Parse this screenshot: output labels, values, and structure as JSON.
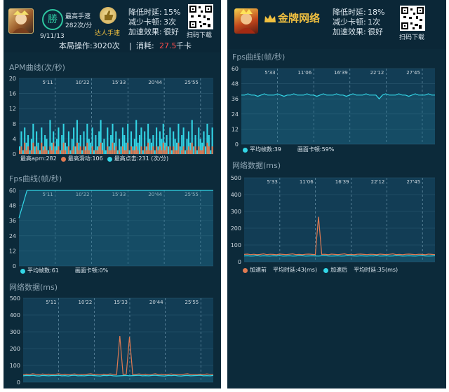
{
  "left": {
    "header": {
      "win_text": "勝",
      "rank_title": "最高手速",
      "rank_value": "282次/分",
      "badge_label": "达人手速",
      "date": "9/11/13",
      "reduce_delay_label": "降低时延:",
      "reduce_delay_value": "15%",
      "reduce_lag_label": "减少卡顿:",
      "reduce_lag_value": "3次",
      "effect_label": "加速效果:",
      "effect_value": "很好",
      "scan_label": "扫码下载",
      "ops_text": "本局操作:3020次",
      "separator": "|",
      "cost_label": "消耗:",
      "cost_value": "27.5",
      "cost_unit": "千卡"
    },
    "apm": {
      "title": "APM曲线(次/秒)",
      "y_ticks": [
        "20",
        "16",
        "12",
        "8",
        "4",
        "0"
      ],
      "x_ticks": [
        "5'11",
        "10'22",
        "15'33",
        "20'44",
        "25'55"
      ],
      "legend": {
        "max_apm": "最高apm:282",
        "max_swipe": "最高滑动:106",
        "max_tap": "最高点击:231 (次/分)"
      }
    },
    "fps": {
      "title": "Fps曲线(帧/秒)",
      "y_ticks": [
        "60",
        "48",
        "36",
        "24",
        "12",
        "0"
      ],
      "x_ticks": [
        "5'11",
        "10'22",
        "15'33",
        "20'44",
        "25'55"
      ],
      "legend": {
        "avg": "平均帧数:61",
        "stutter": "画面卡顿:0%"
      }
    },
    "net": {
      "title": "网络数据(ms)",
      "y_ticks": [
        "500",
        "400",
        "300",
        "200",
        "100",
        "0"
      ],
      "x_ticks": [
        "5'11",
        "10'22",
        "15'33",
        "20'44",
        "25'55"
      ]
    }
  },
  "right": {
    "header": {
      "logo_text": "金牌网络",
      "reduce_delay_label": "降低时延:",
      "reduce_delay_value": "18%",
      "reduce_lag_label": "减少卡顿:",
      "reduce_lag_value": "1次",
      "effect_label": "加速效果:",
      "effect_value": "很好",
      "scan_label": "扫码下载"
    },
    "fps": {
      "title": "Fps曲线(帧/秒)",
      "y_ticks": [
        "60",
        "48",
        "36",
        "24",
        "12",
        "0"
      ],
      "x_ticks": [
        "5'33",
        "11'06",
        "16'39",
        "22'12",
        "27'45"
      ],
      "legend": {
        "avg": "平均帧数:39",
        "stutter": "画面卡顿:59%"
      }
    },
    "net": {
      "title": "网络数据(ms)",
      "y_ticks": [
        "500",
        "400",
        "300",
        "200",
        "100",
        "0"
      ],
      "x_ticks": [
        "5'33",
        "11'06",
        "16'39",
        "22'12",
        "27'45"
      ],
      "legend": {
        "before_label": "加速前",
        "before_avg": "平均时延:43(ms)",
        "after_label": "加速后",
        "after_avg": "平均时延:35(ms)"
      }
    }
  },
  "colors": {
    "bg": "#0c2a3a",
    "plot": "#123d55",
    "cyan": "#33d6e6",
    "orange": "#e07a52",
    "gold": "#f0c040",
    "red": "#ff4b4b",
    "text": "#dbe6ee"
  },
  "chart_data": [
    {
      "type": "bar",
      "title": "APM曲线(次/秒)",
      "x_ticks": [
        "5'11",
        "10'22",
        "15'33",
        "20'44",
        "25'55"
      ],
      "ylim": [
        0,
        20
      ],
      "series": [
        {
          "name": "最高点击",
          "color": "#33d6e6",
          "values": [
            2,
            6,
            1,
            7,
            3,
            5,
            1,
            4,
            8,
            2,
            6,
            3,
            1,
            7,
            2,
            5,
            4,
            1,
            9,
            3,
            6,
            2,
            4,
            7,
            1,
            5,
            8,
            3,
            2,
            6,
            1,
            4,
            7,
            2,
            9,
            3,
            5,
            1,
            6,
            2,
            8,
            4,
            3,
            7,
            1,
            5,
            2,
            6,
            9,
            3,
            4,
            1,
            7,
            2,
            5,
            8,
            3,
            6,
            1,
            4,
            2,
            7,
            5,
            3,
            8,
            1,
            6,
            2,
            4,
            9,
            3,
            5,
            7,
            1,
            6,
            2,
            8,
            4,
            3,
            5,
            1,
            7,
            2,
            6,
            4,
            8,
            3,
            5,
            2,
            7,
            1,
            6,
            4,
            3,
            8,
            2,
            5,
            7,
            1,
            4,
            6,
            3,
            9,
            2,
            5,
            1,
            7,
            4,
            3,
            6,
            2,
            8,
            5,
            1,
            7
          ]
        },
        {
          "name": "最高滑动",
          "color": "#e07a52",
          "values": [
            1,
            2,
            0,
            3,
            1,
            2,
            0,
            1,
            3,
            0,
            2,
            1,
            0,
            3,
            1,
            2,
            1,
            0,
            2,
            1,
            3,
            0,
            1,
            2,
            0,
            1,
            3,
            1,
            0,
            2,
            0,
            1,
            2,
            0,
            3,
            1,
            2,
            0,
            2,
            1,
            3,
            1,
            0,
            2,
            0,
            1,
            1,
            2,
            3,
            1,
            0,
            0,
            2,
            1,
            1,
            3,
            1,
            2,
            0,
            1,
            0,
            2,
            1,
            1,
            3,
            0,
            2,
            1,
            1,
            2,
            1,
            0,
            2,
            0,
            2,
            1,
            3,
            1,
            1,
            2,
            0,
            2,
            1,
            2,
            1,
            3,
            1,
            2,
            0,
            2,
            0,
            2,
            1,
            1,
            3,
            0,
            1,
            2,
            0,
            1,
            2,
            1,
            3,
            0,
            2,
            0,
            2,
            1,
            1,
            2,
            0,
            3,
            2,
            0,
            2
          ]
        }
      ]
    },
    {
      "type": "line",
      "title": "Fps曲线(帧/秒)",
      "x_ticks": [
        "5'11",
        "10'22",
        "15'33",
        "20'44",
        "25'55"
      ],
      "ylim": [
        0,
        60
      ],
      "series": [
        {
          "name": "平均帧数",
          "color": "#33d6e6",
          "values": [
            38,
            60,
            61,
            61,
            61,
            61,
            61,
            61,
            61,
            61,
            61,
            61,
            61,
            61,
            61,
            61,
            61,
            61,
            61,
            61,
            61,
            61,
            61,
            61,
            61
          ]
        }
      ]
    },
    {
      "type": "line",
      "title": "网络数据(ms)",
      "x_ticks": [
        "5'11",
        "10'22",
        "15'33",
        "20'44",
        "25'55"
      ],
      "ylim": [
        0,
        500
      ],
      "series": [
        {
          "name": "加速前",
          "color": "#e07a52",
          "values": [
            45,
            48,
            46,
            50,
            47,
            44,
            49,
            46,
            48,
            45,
            47,
            50,
            46,
            48,
            44,
            47,
            49,
            45,
            47,
            46,
            48,
            50,
            46,
            47,
            45,
            48,
            46,
            49,
            47,
            45,
            275,
            46,
            48,
            270,
            45,
            47,
            49,
            46,
            48,
            45,
            47,
            50,
            46,
            48,
            44,
            47,
            49,
            45,
            47,
            46,
            48,
            50,
            46,
            47,
            45,
            48,
            46,
            49,
            47,
            45
          ]
        },
        {
          "name": "加速后",
          "color": "#33d6e6",
          "values": [
            38,
            40,
            39,
            41,
            38,
            37,
            40,
            39,
            38,
            40,
            39,
            41,
            38,
            39,
            37,
            40,
            41,
            38,
            39,
            38,
            40,
            41,
            39,
            38,
            37,
            40,
            39,
            41,
            38,
            37,
            38,
            39,
            40,
            38,
            39,
            40,
            41,
            38,
            39,
            38,
            40,
            41,
            39,
            38,
            37,
            40,
            39,
            41,
            38,
            37,
            39,
            40,
            38,
            39,
            40,
            41,
            38,
            39,
            38,
            40
          ]
        }
      ]
    },
    {
      "type": "line",
      "title": "Fps曲线(帧/秒)",
      "x_ticks": [
        "5'33",
        "11'06",
        "16'39",
        "22'12",
        "27'45"
      ],
      "ylim": [
        0,
        60
      ],
      "series": [
        {
          "name": "平均帧数",
          "color": "#33d6e6",
          "values": [
            39,
            39,
            40,
            39,
            39,
            38,
            39,
            40,
            39,
            39,
            39,
            40,
            39,
            38,
            39,
            39,
            40,
            39,
            39,
            39,
            40,
            39,
            39,
            38,
            39,
            40,
            39,
            39,
            39,
            40,
            39,
            39,
            38,
            39,
            40,
            39,
            39,
            39,
            40,
            39,
            39,
            39,
            36,
            39,
            40,
            39,
            39,
            39,
            40,
            39,
            39,
            38,
            39,
            40,
            39,
            39,
            39,
            40,
            39,
            39
          ]
        }
      ]
    },
    {
      "type": "line",
      "title": "网络数据(ms)",
      "x_ticks": [
        "5'33",
        "11'06",
        "16'39",
        "22'12",
        "27'45"
      ],
      "ylim": [
        0,
        500
      ],
      "series": [
        {
          "name": "加速前",
          "color": "#e07a52",
          "values": [
            44,
            46,
            43,
            45,
            42,
            44,
            47,
            43,
            45,
            44,
            42,
            46,
            44,
            43,
            45,
            47,
            43,
            44,
            42,
            45,
            46,
            44,
            43,
            268,
            44,
            45,
            42,
            46,
            44,
            43,
            45,
            47,
            43,
            44,
            42,
            45,
            46,
            44,
            43,
            45,
            44,
            42,
            46,
            44,
            43,
            45,
            47,
            43,
            44,
            42,
            45,
            46,
            44,
            43,
            45,
            44,
            42,
            46,
            44,
            43
          ]
        },
        {
          "name": "加速后",
          "color": "#33d6e6",
          "values": [
            35,
            36,
            34,
            35,
            37,
            34,
            36,
            35,
            34,
            36,
            35,
            37,
            34,
            35,
            36,
            34,
            35,
            37,
            36,
            34,
            35,
            36,
            35,
            34,
            36,
            37,
            35,
            34,
            35,
            36,
            34,
            35,
            37,
            36,
            35,
            34,
            36,
            35,
            34,
            36,
            35,
            37,
            34,
            35,
            36,
            34,
            35,
            37,
            36,
            34,
            35,
            36,
            35,
            34,
            36,
            37,
            35,
            34,
            35,
            36
          ]
        }
      ]
    }
  ]
}
